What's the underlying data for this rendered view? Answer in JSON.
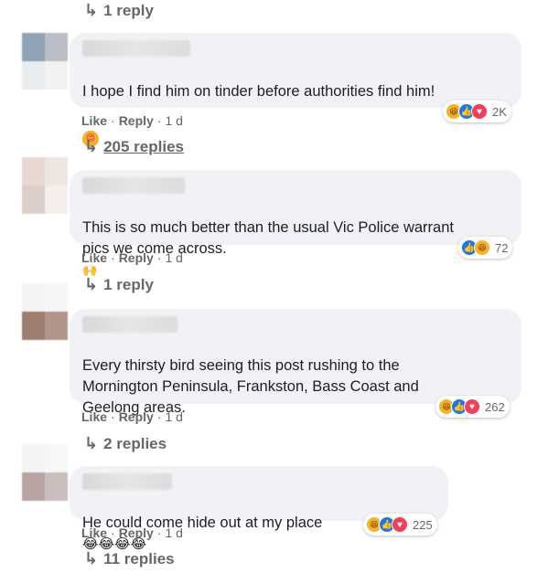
{
  "top_reply": {
    "arrow": "↳",
    "label": "1 reply"
  },
  "comments": [
    {
      "text": "I hope I find him on tinder before authorities find him!",
      "emoji": "😍",
      "actions": {
        "like": "Like",
        "reply": "Reply",
        "time": "1 d"
      },
      "reactions": {
        "icons": [
          "haha-icon",
          "like-icon",
          "love-icon"
        ],
        "count": "2K"
      },
      "replies_label": "205 replies"
    },
    {
      "text": "This is so much better than the usual Vic Police warrant\npics we come across.",
      "emoji": "🙌",
      "actions": {
        "like": "Like",
        "reply": "Reply",
        "time": "1 d"
      },
      "reactions": {
        "icons": [
          "like-icon",
          "haha-icon"
        ],
        "count": "72"
      },
      "replies_label": "1 reply"
    },
    {
      "text": "Every thirsty bird seeing this post rushing to the\nMornington Peninsula, Frankston, Bass Coast and\nGeelong areas.",
      "actions": {
        "like": "Like",
        "reply": "Reply",
        "time": "1 d"
      },
      "reactions": {
        "icons": [
          "haha-icon",
          "like-icon",
          "love-icon"
        ],
        "count": "262"
      },
      "replies_label": "2 replies"
    },
    {
      "text": "He could come hide out at my place",
      "emoji": "😂😂😂😂",
      "actions": {
        "like": "Like",
        "reply": "Reply",
        "time": "1 d"
      },
      "reactions": {
        "icons": [
          "haha-icon",
          "like-icon",
          "love-icon"
        ],
        "count": "225"
      },
      "replies_label": "11 replies"
    }
  ],
  "colors": {
    "bubble": "#f0f2f5",
    "meta": "#65676b",
    "like_blue": "#1877f2",
    "love_red": "#f33e58",
    "haha_yellow": "#f7b125"
  }
}
